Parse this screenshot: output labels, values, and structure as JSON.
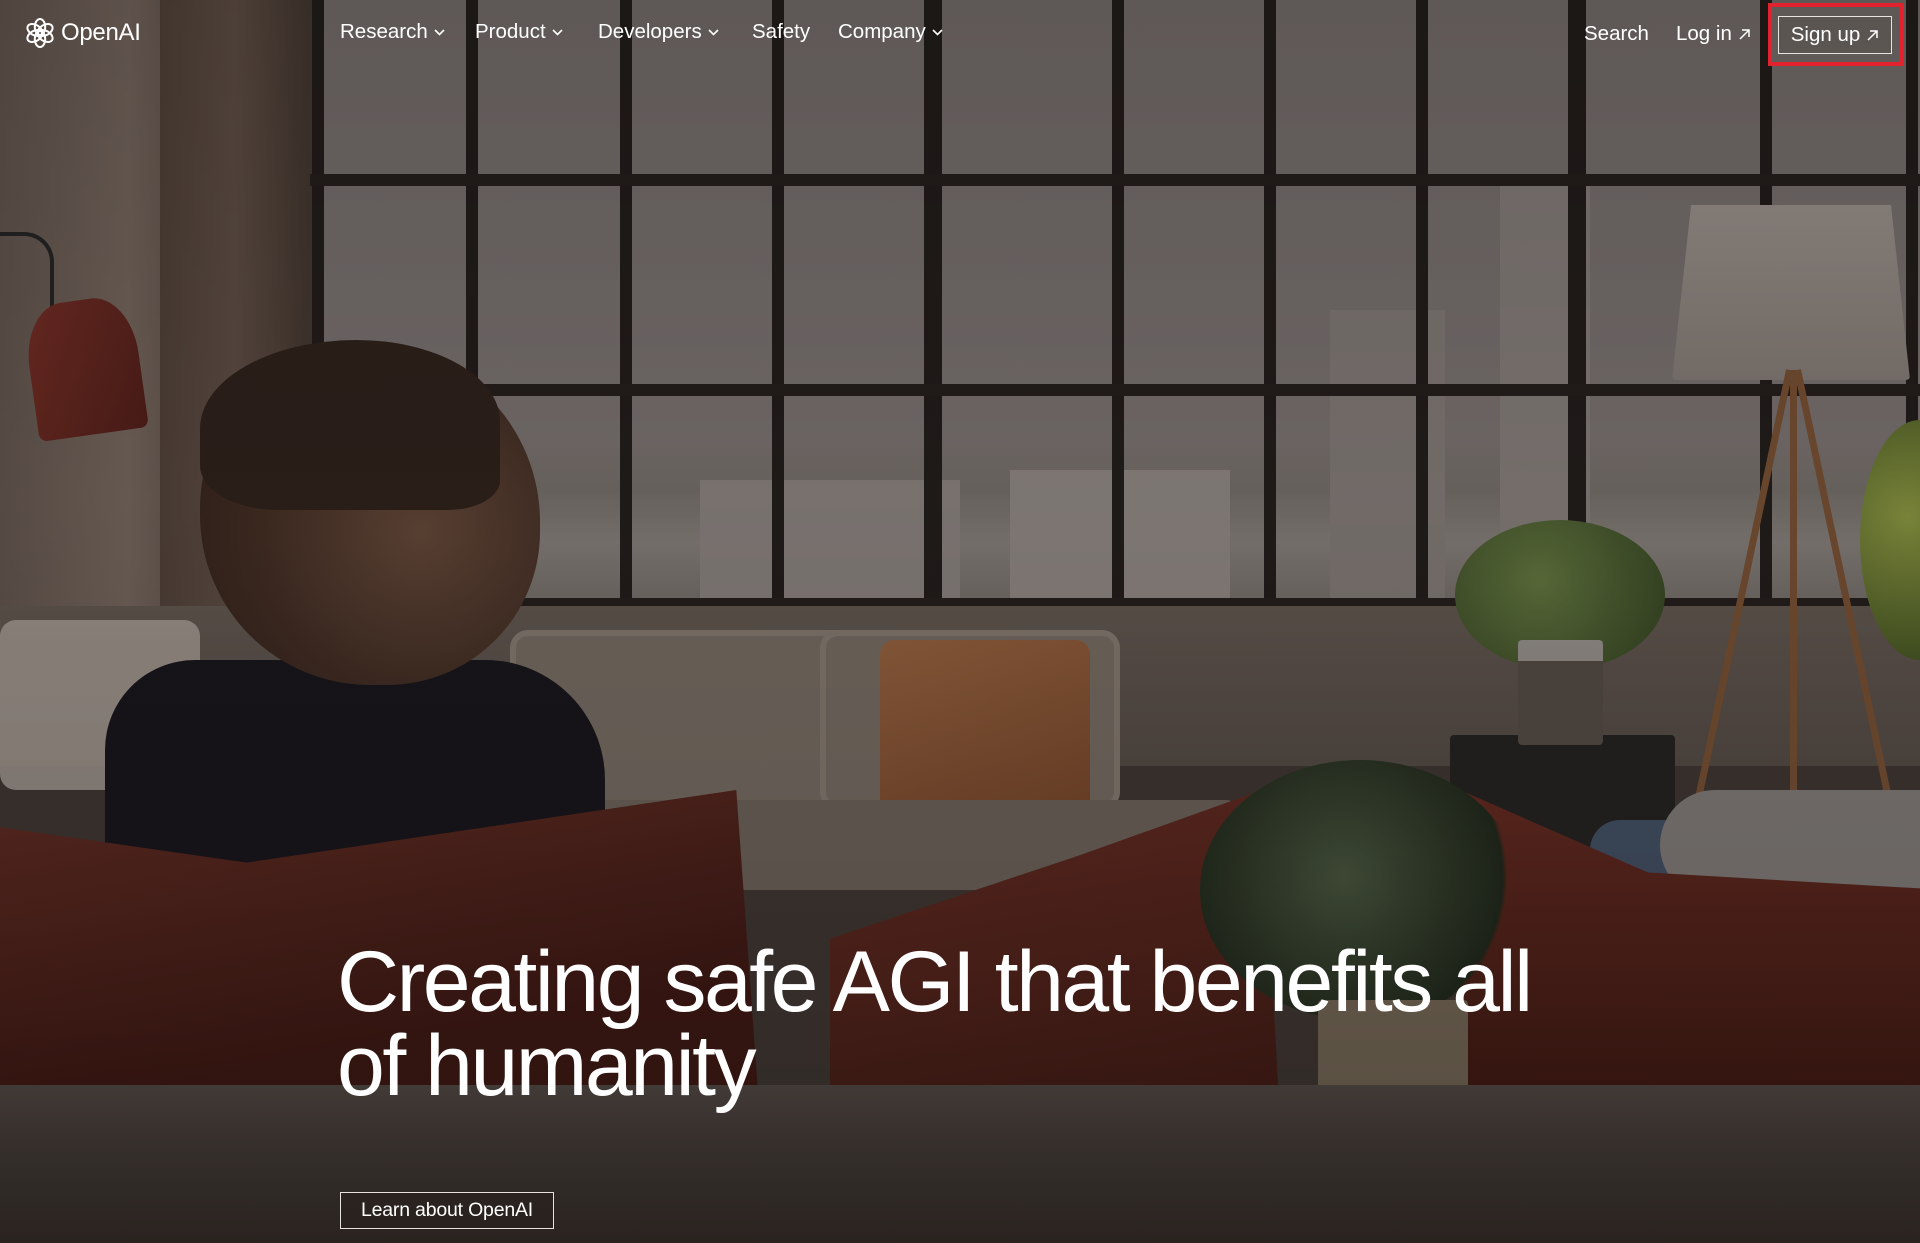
{
  "brand": {
    "name": "OpenAI",
    "logo_icon": "openai-knot-icon"
  },
  "nav": {
    "items": [
      {
        "label": "Research",
        "has_dropdown": true
      },
      {
        "label": "Product",
        "has_dropdown": true
      },
      {
        "label": "Developers",
        "has_dropdown": true
      },
      {
        "label": "Safety",
        "has_dropdown": false
      },
      {
        "label": "Company",
        "has_dropdown": true
      }
    ],
    "search_label": "Search",
    "login_label": "Log in",
    "signup_label": "Sign up",
    "external_icon": "arrow-up-right-icon",
    "dropdown_icon": "chevron-down-icon"
  },
  "hero": {
    "headline_line1": "Creating safe AGI that benefits all",
    "headline_line2": "of humanity",
    "cta_label": "Learn about OpenAI",
    "background": "photo of a person sitting on a sofa in a loft with large windows"
  },
  "highlight": {
    "target": "Sign up",
    "color": "#e0232e"
  }
}
